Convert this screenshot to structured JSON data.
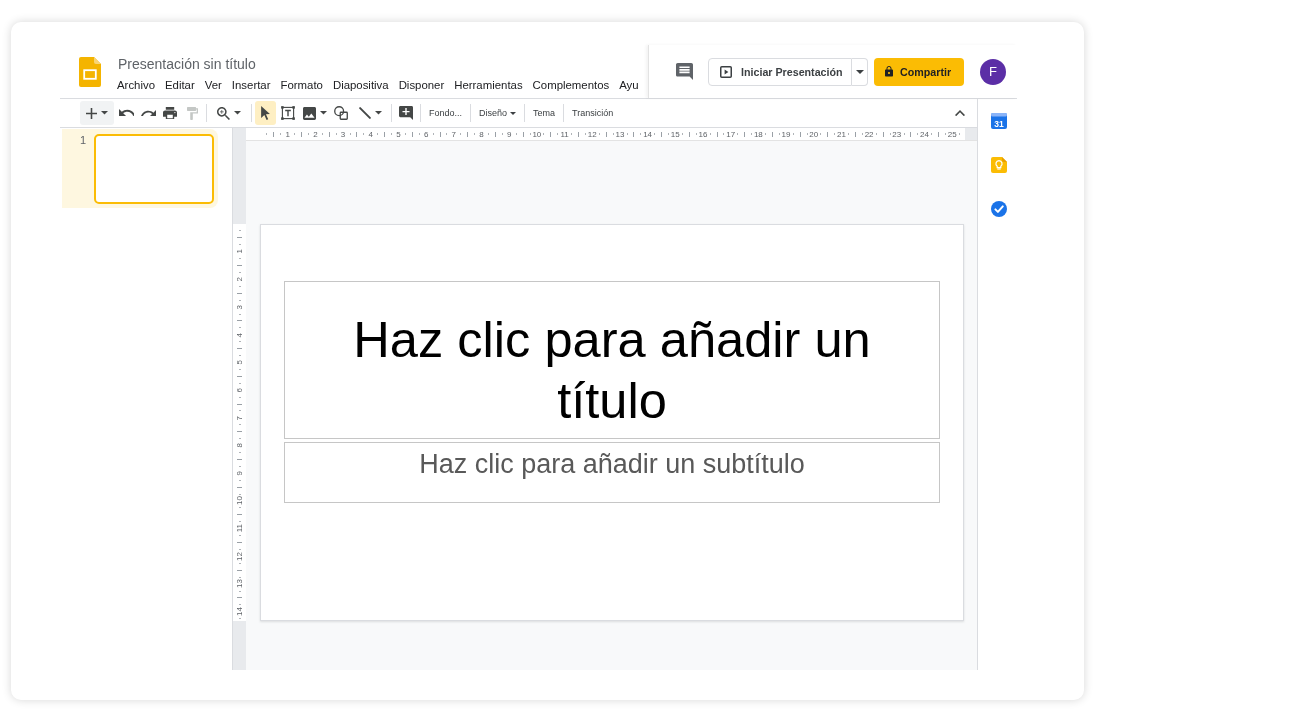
{
  "header": {
    "title": "Presentación sin título",
    "menu": [
      "Archivo",
      "Editar",
      "Ver",
      "Insertar",
      "Formato",
      "Diapositiva",
      "Disponer",
      "Herramientas",
      "Complementos",
      "Ayu"
    ],
    "present_button": "Iniciar Presentación",
    "share_button": "Compartir",
    "avatar": "F"
  },
  "toolbar": {
    "groups": [
      {
        "items": [
          {
            "kind": "plus",
            "caret": true,
            "disabled": false
          },
          {
            "kind": "undo",
            "caret": false,
            "disabled": false
          },
          {
            "kind": "redo",
            "caret": false,
            "disabled": false
          },
          {
            "kind": "print",
            "caret": false,
            "disabled": false
          },
          {
            "kind": "paint_roller",
            "caret": false,
            "disabled": true
          }
        ]
      },
      {
        "items": [
          {
            "kind": "zoom",
            "caret": true
          }
        ]
      },
      {
        "items": [
          {
            "kind": "cursor",
            "caret": false,
            "selected": true
          },
          {
            "kind": "text_box",
            "caret": false,
            "selected": false
          },
          {
            "kind": "image",
            "caret": true,
            "selected": false
          },
          {
            "kind": "shapes",
            "caret": false,
            "selected": false
          },
          {
            "kind": "line",
            "caret": true,
            "selected": false
          }
        ]
      },
      {
        "items": [
          {
            "kind": "add_comment",
            "caret": false
          }
        ]
      },
      {
        "items": [
          {
            "kind": "text",
            "label": "Fondo...",
            "caret": false
          }
        ]
      },
      {
        "items": [
          {
            "kind": "text",
            "label": "Diseño",
            "caret": true
          }
        ]
      },
      {
        "items": [
          {
            "kind": "text",
            "label": "Tema",
            "caret": false
          }
        ]
      },
      {
        "items": [
          {
            "kind": "text",
            "label": "Transición",
            "caret": false
          }
        ]
      }
    ]
  },
  "filmstrip": {
    "slides": [
      {
        "number": "1",
        "selected": true
      }
    ]
  },
  "rulers": {
    "horizontal": [
      "1",
      "2",
      "3",
      "4",
      "5",
      "6",
      "7",
      "8",
      "9",
      "10",
      "11",
      "12",
      "13",
      "14",
      "15",
      "16",
      "17",
      "18",
      "19",
      "20",
      "21",
      "22",
      "23",
      "24",
      "25"
    ],
    "vertical": [
      "1",
      "2",
      "3",
      "4",
      "5",
      "6",
      "7",
      "8",
      "9",
      "10",
      "11",
      "12",
      "13",
      "14"
    ]
  },
  "slide": {
    "title_box": {
      "placeholder": "Haz clic para añadir un título"
    },
    "subtitle_box": {
      "placeholder": "Haz clic para añadir un subtítulo"
    }
  },
  "side_panel": {
    "apps": [
      {
        "kind": "calendar",
        "text": "31"
      },
      {
        "kind": "bulb"
      },
      {
        "kind": "check"
      }
    ]
  }
}
